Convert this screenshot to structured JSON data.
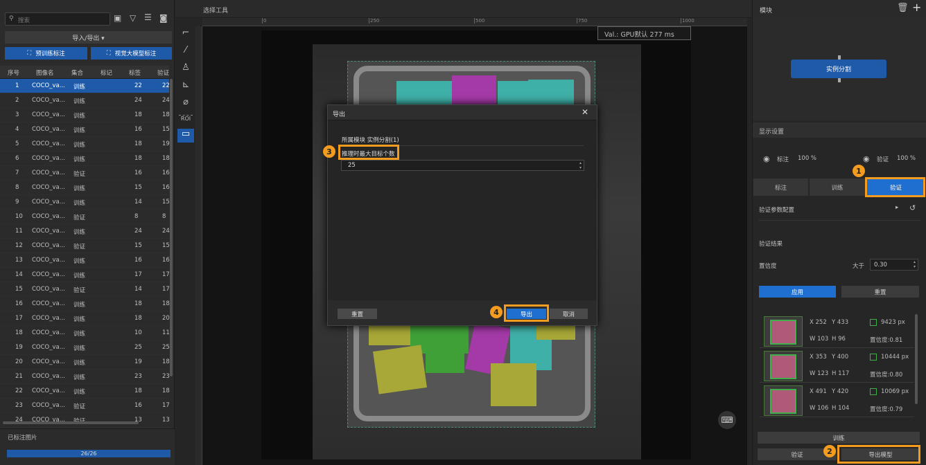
{
  "left": {
    "search_placeholder": "搜索",
    "import_export": "导入/导出 ▾",
    "btn_pretrain": "预训练标注",
    "btn_llm": "视觉大模型标注",
    "columns": [
      "序号",
      "图像名",
      "集合",
      "标记",
      "标签",
      "验证"
    ],
    "rows": [
      {
        "n": "1",
        "name": "COCO_va...",
        "set": "训练",
        "tag": "22",
        "val": "22"
      },
      {
        "n": "2",
        "name": "COCO_va...",
        "set": "训练",
        "tag": "24",
        "val": "24"
      },
      {
        "n": "3",
        "name": "COCO_va...",
        "set": "训练",
        "tag": "18",
        "val": "18"
      },
      {
        "n": "4",
        "name": "COCO_va...",
        "set": "训练",
        "tag": "16",
        "val": "15"
      },
      {
        "n": "5",
        "name": "COCO_va...",
        "set": "训练",
        "tag": "18",
        "val": "19"
      },
      {
        "n": "6",
        "name": "COCO_va...",
        "set": "训练",
        "tag": "18",
        "val": "18"
      },
      {
        "n": "7",
        "name": "COCO_va...",
        "set": "验证",
        "tag": "16",
        "val": "16"
      },
      {
        "n": "8",
        "name": "COCO_va...",
        "set": "训练",
        "tag": "15",
        "val": "16"
      },
      {
        "n": "9",
        "name": "COCO_va...",
        "set": "训练",
        "tag": "14",
        "val": "15"
      },
      {
        "n": "10",
        "name": "COCO_va...",
        "set": "验证",
        "tag": "8",
        "val": "8"
      },
      {
        "n": "11",
        "name": "COCO_va...",
        "set": "训练",
        "tag": "24",
        "val": "24"
      },
      {
        "n": "12",
        "name": "COCO_va...",
        "set": "验证",
        "tag": "15",
        "val": "15"
      },
      {
        "n": "13",
        "name": "COCO_va...",
        "set": "训练",
        "tag": "16",
        "val": "16"
      },
      {
        "n": "14",
        "name": "COCO_va...",
        "set": "训练",
        "tag": "17",
        "val": "17"
      },
      {
        "n": "15",
        "name": "COCO_va...",
        "set": "验证",
        "tag": "14",
        "val": "17"
      },
      {
        "n": "16",
        "name": "COCO_va...",
        "set": "训练",
        "tag": "18",
        "val": "18"
      },
      {
        "n": "17",
        "name": "COCO_va...",
        "set": "训练",
        "tag": "18",
        "val": "20"
      },
      {
        "n": "18",
        "name": "COCO_va...",
        "set": "训练",
        "tag": "10",
        "val": "11"
      },
      {
        "n": "19",
        "name": "COCO_va...",
        "set": "训练",
        "tag": "25",
        "val": "25"
      },
      {
        "n": "20",
        "name": "COCO_va...",
        "set": "训练",
        "tag": "19",
        "val": "18"
      },
      {
        "n": "21",
        "name": "COCO_va...",
        "set": "训练",
        "tag": "23",
        "val": "23"
      },
      {
        "n": "22",
        "name": "COCO_va...",
        "set": "训练",
        "tag": "18",
        "val": "18"
      },
      {
        "n": "23",
        "name": "COCO_va...",
        "set": "验证",
        "tag": "16",
        "val": "17"
      },
      {
        "n": "24",
        "name": "COCO_va...",
        "set": "验证",
        "tag": "13",
        "val": "13"
      }
    ],
    "annotated_label": "已标注图片",
    "progress_text": "26/26",
    "progress_fraction": 1.0
  },
  "tools": {
    "title": "选择工具",
    "roi_label": "ROI"
  },
  "canvas": {
    "val_info": "Val.: GPU默认 277 ms",
    "ruler_labels": [
      "0",
      "250",
      "500",
      "750",
      "1000"
    ]
  },
  "dialog": {
    "title": "导出",
    "module_line": "所属模块 实例分割(1)",
    "field_label": "推理时最大目标个数",
    "field_value": "25",
    "reset": "重置",
    "export": "导出",
    "cancel": "取消"
  },
  "right": {
    "module_header": "模块",
    "module_node": "实例分割",
    "display_settings": "显示设置",
    "annotate_label": "标注",
    "annotate_pct": "100 %",
    "verify_label": "验证",
    "verify_pct": "100 %",
    "tabs": [
      "标注",
      "训练",
      "验证"
    ],
    "verify_params": "验证参数配置",
    "verify_results": "验证结果",
    "confidence": "置信度",
    "greater": "大于",
    "confidence_value": "0.30",
    "apply": "应用",
    "reset": "重置",
    "results": [
      {
        "x": "X 252",
        "y": "Y 433",
        "px": "9423 px",
        "w": "W 103",
        "h": "H 96",
        "conf": "置信度:0.81"
      },
      {
        "x": "X 353",
        "y": "Y 400",
        "px": "10444 px",
        "w": "W 123",
        "h": "H 117",
        "conf": "置信度:0.80"
      },
      {
        "x": "X 491",
        "y": "Y 420",
        "px": "10069 px",
        "w": "W 106",
        "h": "H 104",
        "conf": "置信度:0.79"
      }
    ],
    "train_btn": "训练",
    "verify_btn": "验证",
    "export_model_btn": "导出模型"
  },
  "callouts": [
    "1",
    "2",
    "3",
    "4"
  ],
  "colors": {
    "accent": "#1f6fd1",
    "highlight": "#f39c1f",
    "selected_row": "#1f5aa8"
  }
}
